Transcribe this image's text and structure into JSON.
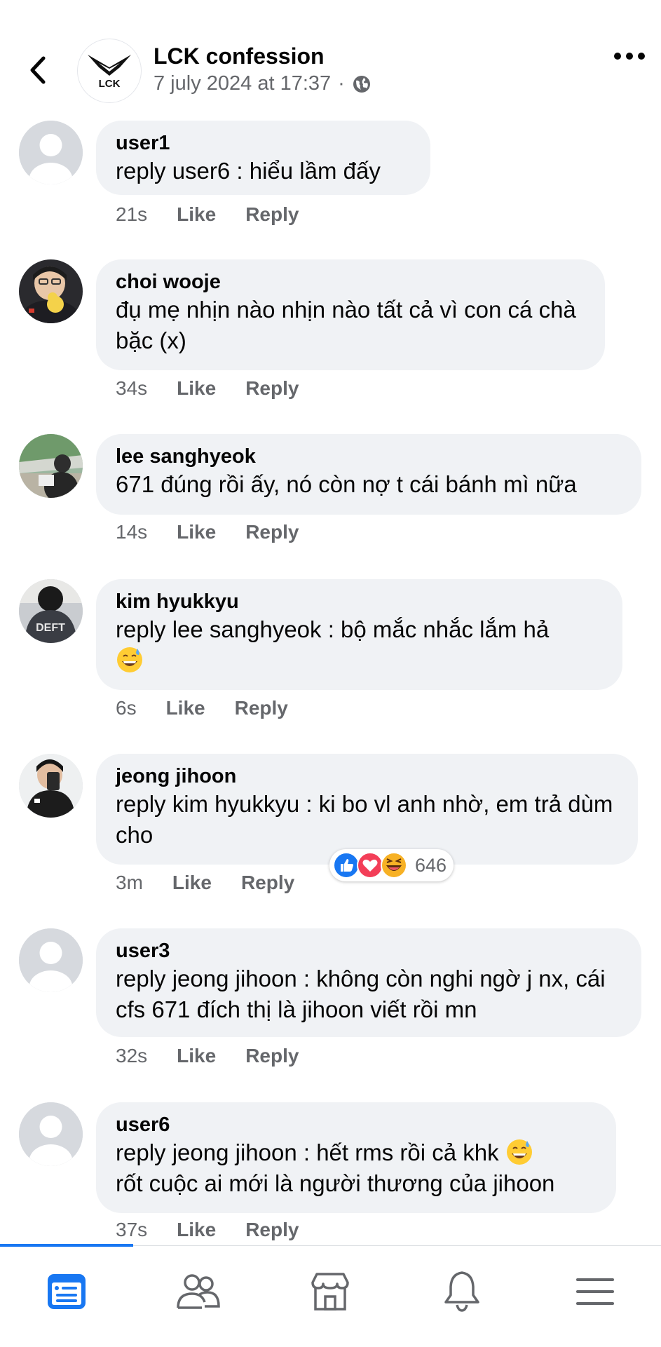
{
  "header": {
    "page_name": "LCK confession",
    "timestamp": "7 july 2024 at 17:37",
    "separator": "·",
    "logo_text": "LCK"
  },
  "comments": [
    {
      "author": "user1",
      "text": "reply user6 : hiểu lầm đấy",
      "time": "21s",
      "like": "Like",
      "reply": "Reply"
    },
    {
      "author": "choi wooje",
      "text": "đụ mẹ nhịn nào nhịn nào tất cả vì con cá chà bặc (x)",
      "time": "34s",
      "like": "Like",
      "reply": "Reply"
    },
    {
      "author": "lee sanghyeok",
      "text": "671 đúng rồi ấy, nó còn nợ t cái bánh mì nữa",
      "time": "14s",
      "like": "Like",
      "reply": "Reply"
    },
    {
      "author": "kim hyukkyu",
      "text": "reply lee sanghyeok : bộ mắc nhắc lắm hả",
      "time": "6s",
      "like": "Like",
      "reply": "Reply",
      "avatar_text": "DEFT"
    },
    {
      "author": "jeong jihoon",
      "text": "reply kim hyukkyu : ki bo vl anh nhờ, em trả dùm cho",
      "time": "3m",
      "like": "Like",
      "reply": "Reply",
      "reaction_count": "646"
    },
    {
      "author": "user3",
      "text": "reply jeong jihoon : không còn nghi ngờ j nx, cái cfs 671 đích thị là jihoon viết rồi mn",
      "time": "32s",
      "like": "Like",
      "reply": "Reply"
    },
    {
      "author": "user6",
      "text_line1": "reply jeong jihoon : hết rms rồi cả khk",
      "text_line2": "rốt cuộc ai mới là người thương của jihoon",
      "time": "37s",
      "like": "Like",
      "reply": "Reply"
    }
  ],
  "icons": {
    "back": "chevron-left-icon",
    "more": "more-horizontal-icon",
    "privacy": "globe-icon",
    "nav": [
      "feed-icon",
      "friends-icon",
      "marketplace-icon",
      "notifications-icon",
      "menu-icon"
    ],
    "reactions": [
      "like-reaction-icon",
      "love-reaction-icon",
      "haha-reaction-icon"
    ]
  },
  "colors": {
    "accent": "#1877f2",
    "bubble": "#f0f2f5",
    "meta_text": "#65676b"
  }
}
